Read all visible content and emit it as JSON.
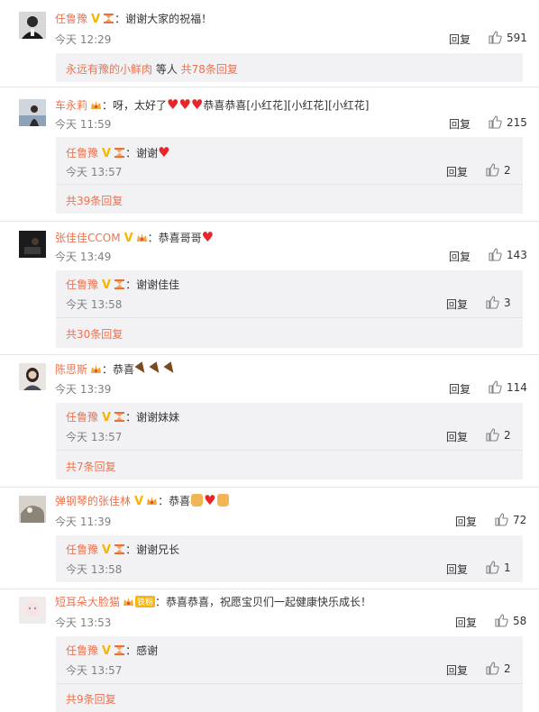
{
  "colors": {
    "username": "#eb7350",
    "gold_v": "#f7b500",
    "heart": "#e8262a",
    "reply_box_bg": "#f2f2f5",
    "meta": "#808080"
  },
  "comments": [
    {
      "user": "任鲁豫",
      "text": "：谢谢大家的祝福！",
      "time": "今天 12:29",
      "reply_label": "回复",
      "likes": "591",
      "more_link": {
        "prefix": "永远有豫的小鲜肉",
        "middle": " 等人 ",
        "count": "共78条回复"
      }
    },
    {
      "user": "车永莉",
      "text_pre": "：呀，太好了",
      "text_post": "恭喜恭喜[小红花][小红花][小红花]",
      "time": "今天 11:59",
      "reply_label": "回复",
      "likes": "215",
      "sub": {
        "user": "任鲁豫",
        "text": "：谢谢",
        "time": "今天 13:57",
        "reply_label": "回复",
        "likes": "2"
      },
      "more_count": "共39条回复"
    },
    {
      "user": "张佳佳CCOM",
      "text": "：恭喜哥哥",
      "time": "今天 13:49",
      "reply_label": "回复",
      "likes": "143",
      "sub": {
        "user": "任鲁豫",
        "text": "：谢谢佳佳",
        "time": "今天 13:58",
        "reply_label": "回复",
        "likes": "3"
      },
      "more_count": "共30条回复"
    },
    {
      "user": "陈思斯",
      "text": "：恭喜",
      "time": "今天 13:39",
      "reply_label": "回复",
      "likes": "114",
      "sub": {
        "user": "任鲁豫",
        "text": "：谢谢妹妹",
        "time": "今天 13:57",
        "reply_label": "回复",
        "likes": "2"
      },
      "more_count": "共7条回复"
    },
    {
      "user": "弹钢琴的张佳林",
      "text": "：恭喜",
      "time": "今天 11:39",
      "reply_label": "回复",
      "likes": "72",
      "sub": {
        "user": "任鲁豫",
        "text": "：谢谢兄长",
        "time": "今天 13:58",
        "reply_label": "回复",
        "likes": "1"
      }
    },
    {
      "user": "短耳朵大脸猫",
      "fan_badge": "铁粉",
      "text": "：恭喜恭喜，祝愿宝贝们一起健康快乐成长！",
      "time": "今天 13:53",
      "reply_label": "回复",
      "likes": "58",
      "sub": {
        "user": "任鲁豫",
        "text": "：感谢",
        "time": "今天 13:57",
        "reply_label": "回复",
        "likes": "2"
      },
      "more_count": "共9条回复"
    }
  ]
}
